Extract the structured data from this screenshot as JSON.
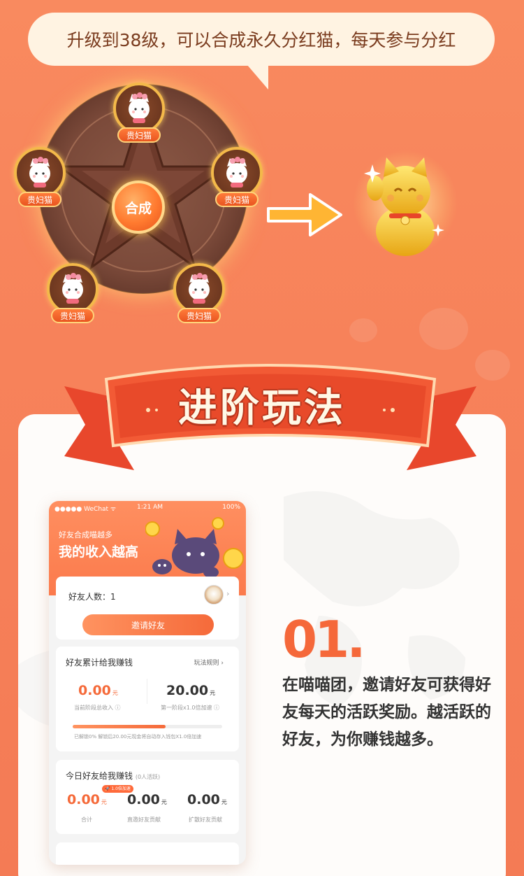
{
  "banner": {
    "text": "升级到38级，可以合成永久分红猫，每天参与分红"
  },
  "wheel": {
    "center_label": "合成",
    "nodes": [
      {
        "label": "贵妇猫"
      },
      {
        "label": "贵妇猫"
      },
      {
        "label": "贵妇猫"
      },
      {
        "label": "贵妇猫"
      },
      {
        "label": "贵妇猫"
      }
    ]
  },
  "section": {
    "title": "进阶玩法"
  },
  "phone": {
    "status": {
      "carrier": "●●●●● WeChat ᯤ",
      "time": "1:21 AM",
      "battery": "100%"
    },
    "header": {
      "subtitle": "好友合成喵越多",
      "title": "我的收入越高"
    },
    "friends_card": {
      "count_label": "好友人数：1",
      "invite_button": "邀请好友"
    },
    "earn_card": {
      "title": "好友累计给我赚钱",
      "rules_link": "玩法规则",
      "left_value": "0.00",
      "left_unit": "元",
      "left_caption": "当前阶段总收入 ⓘ",
      "right_value": "20.00",
      "right_unit": "元",
      "right_caption": "第一阶段x1.0倍加速 ⓘ",
      "progress": 0.62,
      "footnote": "已解锁0%  解锁后20.00元现金将自动存入钱包X1.0倍加速"
    },
    "today_card": {
      "title": "今日好友给我赚钱",
      "active_note": "(0人活跃)",
      "badge": "🚀 1.0倍加速",
      "items": [
        {
          "value": "0.00",
          "unit": "元",
          "caption": "合计"
        },
        {
          "value": "0.00",
          "unit": "元",
          "caption": "直邀好友贡献"
        },
        {
          "value": "0.00",
          "unit": "元",
          "caption": "扩散好友贡献"
        }
      ]
    }
  },
  "step": {
    "number": "01.",
    "description": "在喵喵团，邀请好友可获得好友每天的活跃奖励。越活跃的好友，为你赚钱越多。"
  },
  "colors": {
    "background": "#f8855c",
    "accent": "#f5683a",
    "card": "#fefcfa"
  }
}
